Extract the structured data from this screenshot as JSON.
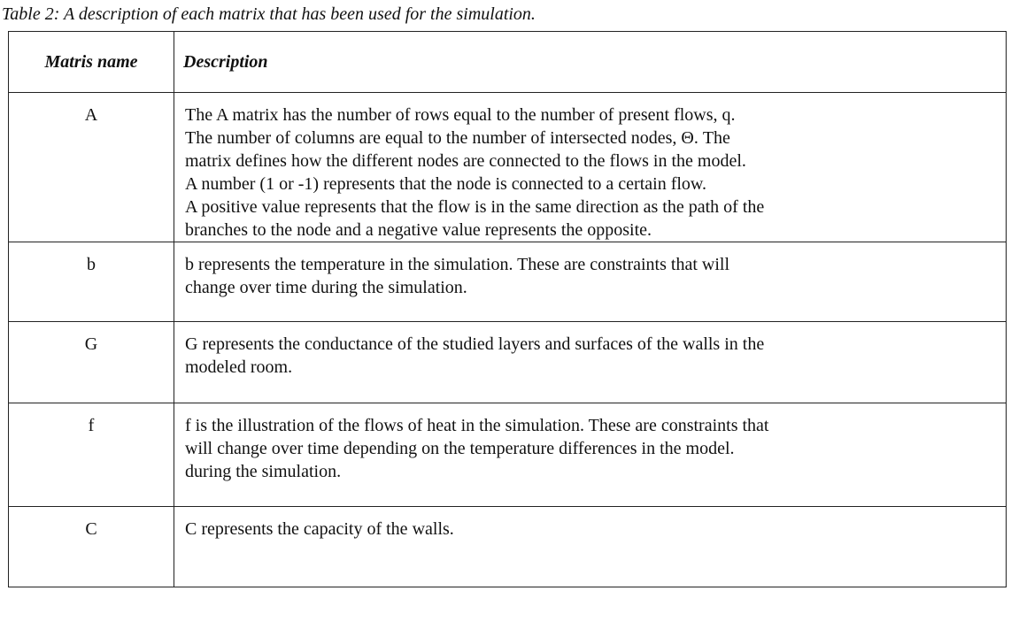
{
  "caption": "Table 2: A description of each matrix that has been used for the simulation.",
  "table": {
    "headers": {
      "name": "Matris name",
      "description": "Description"
    },
    "rows": [
      {
        "name": "A",
        "lines": [
          "The A matrix has the number of rows equal to the number of present flows, q.",
          "The number of columns are equal to the number of intersected nodes, Θ. The",
          "matrix defines how the different nodes are connected to the flows in the model.",
          "A number (1 or -1) represents that the node is connected to a certain flow.",
          "A positive value represents that the flow is in the same direction as the path of the",
          "branches to the node and a negative value represents the opposite."
        ]
      },
      {
        "name": "b",
        "lines": [
          "b represents the temperature in the simulation. These are constraints that will",
          "change over time during the simulation."
        ]
      },
      {
        "name": "G",
        "lines": [
          "G represents the conductance of the studied layers and surfaces of the walls in the",
          "modeled room."
        ]
      },
      {
        "name": "f",
        "lines": [
          "f is the illustration of the flows of heat in the simulation. These are constraints that",
          "will change over time depending on the temperature differences in the model.",
          "during the simulation."
        ]
      },
      {
        "name": "C",
        "lines": [
          "C represents the capacity of the walls."
        ]
      }
    ]
  }
}
